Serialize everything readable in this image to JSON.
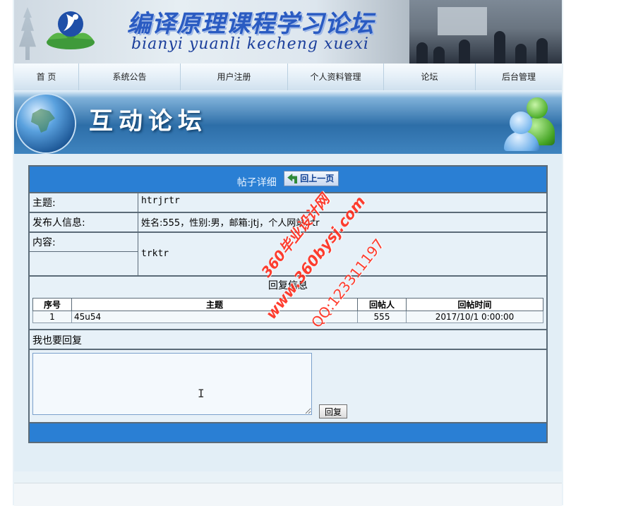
{
  "banner": {
    "title_cn": "编译原理课程学习论坛",
    "title_en": "bianyi yuanli kecheng xuexi"
  },
  "nav": [
    {
      "label": "首 页"
    },
    {
      "label": "系统公告"
    },
    {
      "label": "用户注册"
    },
    {
      "label": "个人资料管理"
    },
    {
      "label": "论坛"
    },
    {
      "label": "后台管理"
    }
  ],
  "forum_header": {
    "title": "互动论坛"
  },
  "post": {
    "panel_title": "帖子详细",
    "back_label": "回上一页",
    "subject_label": "主题:",
    "subject_value": "htrjrtr",
    "author_label": "发布人信息:",
    "author_value": "姓名:555，性别:男，邮箱:jtj，个人网站:rtr",
    "content_label": "内容:",
    "content_value": "trktr"
  },
  "replies": {
    "section_title": "回复信息",
    "columns": [
      "序号",
      "主题",
      "回帖人",
      "回帖时间"
    ],
    "rows": [
      {
        "no": "1",
        "subject": "45u54",
        "author": "555",
        "time": "2017/10/1 0:00:00"
      }
    ]
  },
  "reply_form": {
    "label": "我也要回复",
    "textarea_value": "",
    "submit_label": "回复"
  },
  "watermark": {
    "line1": "360毕业设计网",
    "line2": "www.360bysj.com",
    "line3": "QQ:123311197"
  },
  "colors": {
    "panel_header": "#2a7fd4",
    "watermark": "#ff2a1a",
    "banner_title": "#2a5bc2"
  }
}
